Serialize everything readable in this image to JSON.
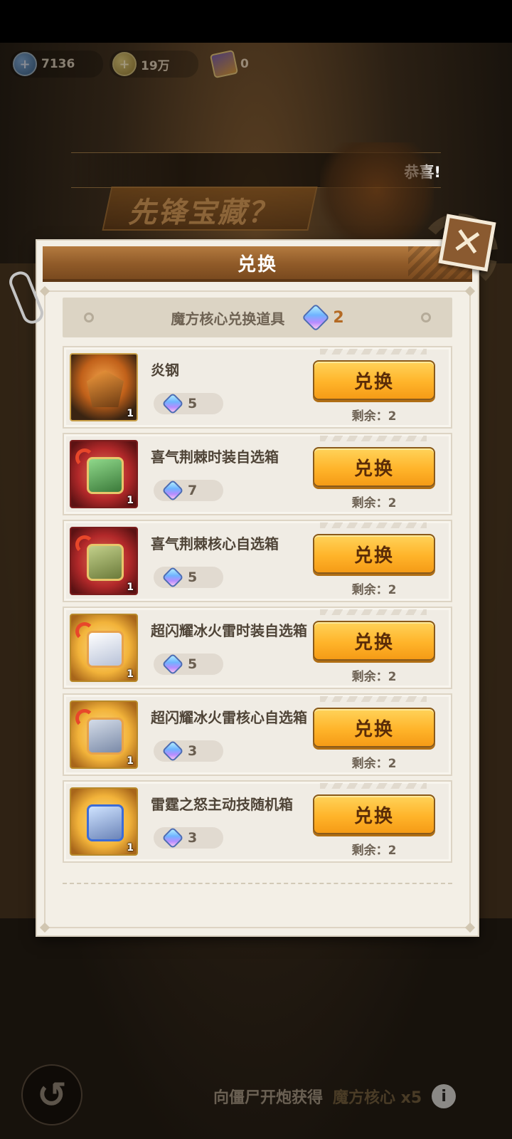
{
  "resources": [
    {
      "icon": "diamond-plus-icon",
      "value": "7136"
    },
    {
      "icon": "coin-plus-icon",
      "value": "19万"
    },
    {
      "icon": "card-icon",
      "value": "0"
    }
  ],
  "background": {
    "congrats": "恭喜!",
    "banner": "先锋宝藏？",
    "hint_text": "向僵尸开炮获得",
    "hint_accent": "魔方核心 x5",
    "back_icon": "back-arrow-icon",
    "info_label": "i"
  },
  "dialog": {
    "title": "兑换",
    "close_label": "✕",
    "header_text": "魔方核心兑换道具",
    "header_count": "2",
    "exchange_label": "兑换",
    "items": [
      {
        "name": "炎钢",
        "cost": "5",
        "qty": "1",
        "remain": "剩余：2"
      },
      {
        "name": "喜气荆棘时装自选箱",
        "cost": "7",
        "qty": "1",
        "remain": "剩余：2"
      },
      {
        "name": "喜气荆棘核心自选箱",
        "cost": "5",
        "qty": "1",
        "remain": "剩余：2"
      },
      {
        "name": "超闪耀冰火雷时装自选箱",
        "cost": "5",
        "qty": "1",
        "remain": "剩余：2"
      },
      {
        "name": "超闪耀冰火雷核心自选箱",
        "cost": "3",
        "qty": "1",
        "remain": "剩余：2"
      },
      {
        "name": "雷霆之怒主动技随机箱",
        "cost": "3",
        "qty": "1",
        "remain": "剩余：2"
      }
    ]
  },
  "colors": {
    "button": "#ffb42a",
    "title_bar": "#8f5a28",
    "card_bg": "#f0ece4"
  }
}
